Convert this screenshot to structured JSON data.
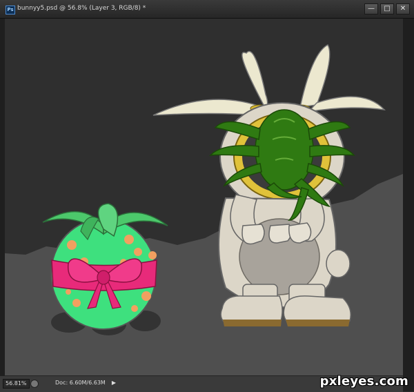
{
  "window": {
    "app_badge": "Ps",
    "title": "bunnyy5.psd @ 56.8% (Layer 3, RGB/8) *",
    "buttons": {
      "minimize": "—",
      "maximize": "□",
      "close": "✕"
    }
  },
  "statusbar": {
    "zoom": "56.81%",
    "doc_size": "Doc: 6.60M/6.63M",
    "arrow": "▶"
  },
  "watermark": "pxleyes.com",
  "colors": {
    "canvas_bg": "#2f2f2f",
    "ground": "#4f4f4f",
    "bunny_body": "#dcd6c8",
    "bunny_ear_inner": "#ece8cf",
    "facehugger": "#2f7a12",
    "egg": "#3ee07e",
    "egg_spots": "#f2a060",
    "bow": "#e82a7a"
  }
}
